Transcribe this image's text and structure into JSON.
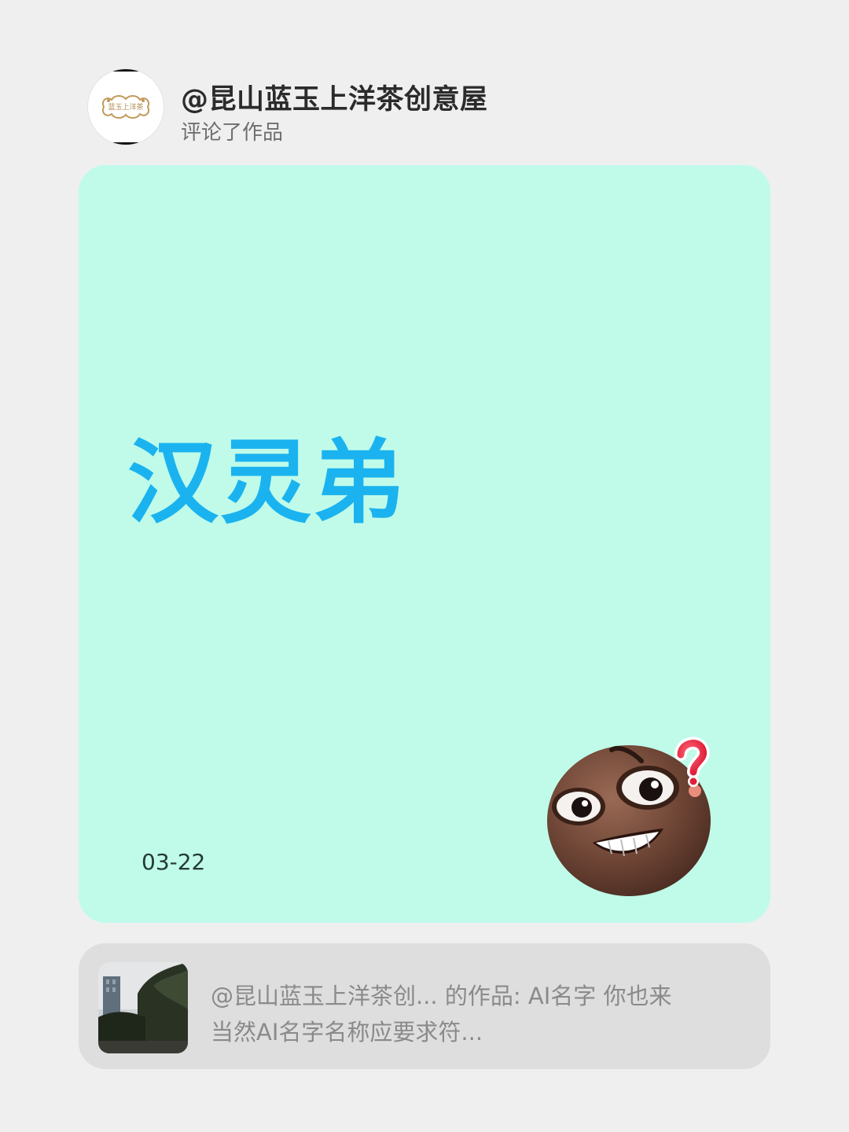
{
  "header": {
    "user_name": "@昆山蓝玉上洋茶创意屋",
    "action": "评论了作品",
    "avatar_logo_text": "蓝玉上洋茶"
  },
  "card": {
    "comment": "汉灵弟",
    "date": "03-22",
    "sticker": "confused-grin-emoji-with-question-mark",
    "background_color": "#c0fbea",
    "text_color": "#1ab3ef"
  },
  "reference": {
    "line1": "@昆山蓝玉上洋茶创... 的作品: AI名字   你也来",
    "line2": "当然AI名字名称应要求符..."
  }
}
